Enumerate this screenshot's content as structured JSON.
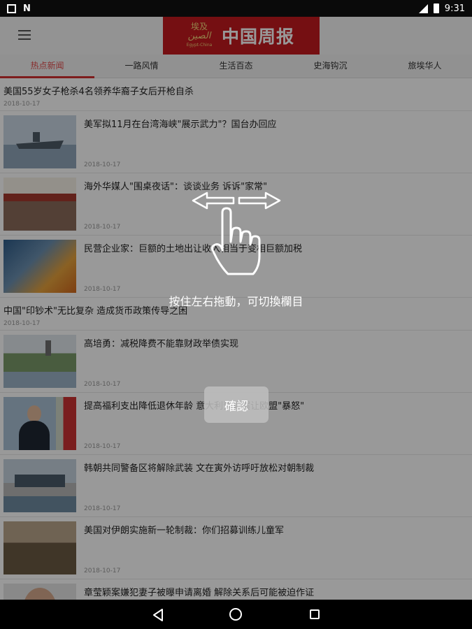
{
  "status_bar": {
    "time": "9:31",
    "notification_letter": "N"
  },
  "header": {
    "logo_sub_line1": "埃及",
    "logo_sub_line2": "الصين",
    "logo_sub_line3": "Egypt-China",
    "logo_title": "中国周报",
    "menu_icon": "hamburger-menu-icon"
  },
  "tabs": [
    {
      "label": "热点新闻",
      "active": true
    },
    {
      "label": "一路风情",
      "active": false
    },
    {
      "label": "生活百态",
      "active": false
    },
    {
      "label": "史海钩沉",
      "active": false
    },
    {
      "label": "旅埃华人",
      "active": false
    }
  ],
  "news": [
    {
      "title": "美国55岁女子枪杀4名领养华裔子女后开枪自杀",
      "date": "2018-10-17"
    },
    {
      "title": "美军拟11月在台湾海峡\"展示武力\"？国台办回应",
      "date": "2018-10-17"
    },
    {
      "title": "海外华媒人\"围桌夜话\"：谈谈业务 诉诉\"家常\"",
      "date": "2018-10-17"
    },
    {
      "title": "民营企业家：巨额的土地出让收入相当于变相巨额加税",
      "date": "2018-10-17"
    },
    {
      "title": "中国\"印钞术\"无比复杂 造成货币政策传导之困",
      "date": "2018-10-17"
    },
    {
      "title": "高培勇：减税降费不能靠财政举债实现",
      "date": "2018-10-17"
    },
    {
      "title": "提高福利支出降低退休年龄 意大利预算案让欧盟\"暴怒\"",
      "date": "2018-10-17"
    },
    {
      "title": "韩朝共同警备区将解除武装 文在寅外访呼吁放松对朝制裁",
      "date": "2018-10-17"
    },
    {
      "title": "美国对伊朗实施新一轮制裁：你们招募训练儿童军",
      "date": "2018-10-17"
    },
    {
      "title": "章莹颖案嫌犯妻子被曝申请离婚 解除关系后可能被迫作证",
      "date": ""
    }
  ],
  "overlay": {
    "hint_text": "按住左右拖動，可切換欄目",
    "confirm_label": "確認"
  }
}
